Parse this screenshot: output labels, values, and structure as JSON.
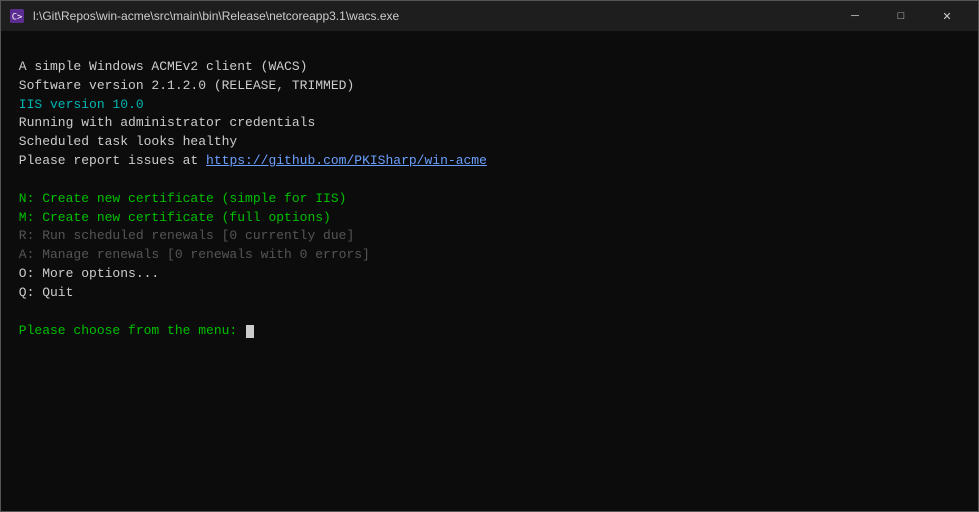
{
  "titlebar": {
    "icon": "terminal-icon",
    "title": "l:\\Git\\Repos\\win-acme\\src\\main\\bin\\Release\\netcoreapp3.1\\wacs.exe",
    "minimize_label": "─",
    "maximize_label": "□",
    "close_label": "✕"
  },
  "console": {
    "lines": [
      {
        "id": "line-blank-1",
        "text": "",
        "color": "color-white"
      },
      {
        "id": "line-simple-client",
        "text": " A simple Windows ACMEv2 client (WACS)",
        "color": "color-white"
      },
      {
        "id": "line-software-version",
        "text": " Software version 2.1.2.0 (RELEASE, TRIMMED)",
        "color": "color-white"
      },
      {
        "id": "line-iis-version",
        "text": " IIS version 10.0",
        "color": "color-cyan"
      },
      {
        "id": "line-running-admin",
        "text": " Running with administrator credentials",
        "color": "color-white"
      },
      {
        "id": "line-scheduled-task",
        "text": " Scheduled task looks healthy",
        "color": "color-white"
      },
      {
        "id": "line-report-issues",
        "text": " Please report issues at https://github.com/PKISharp/win-acme",
        "color": "color-white",
        "link": "https://github.com/PKISharp/win-acme"
      },
      {
        "id": "line-blank-2",
        "text": "",
        "color": "color-white"
      },
      {
        "id": "line-N",
        "text": " N: Create new certificate (simple for IIS)",
        "color": "color-green"
      },
      {
        "id": "line-M",
        "text": " M: Create new certificate (full options)",
        "color": "color-green"
      },
      {
        "id": "line-R",
        "text": " R: Run scheduled renewals [0 currently due]",
        "color": "color-dim"
      },
      {
        "id": "line-A",
        "text": " A: Manage renewals [0 renewals with 0 errors]",
        "color": "color-dim"
      },
      {
        "id": "line-O",
        "text": " O: More options...",
        "color": "color-white"
      },
      {
        "id": "line-Q",
        "text": " Q: Quit",
        "color": "color-white"
      },
      {
        "id": "line-blank-3",
        "text": "",
        "color": "color-white"
      },
      {
        "id": "line-prompt",
        "text": " Please choose from the menu: ",
        "color": "color-green"
      }
    ]
  }
}
